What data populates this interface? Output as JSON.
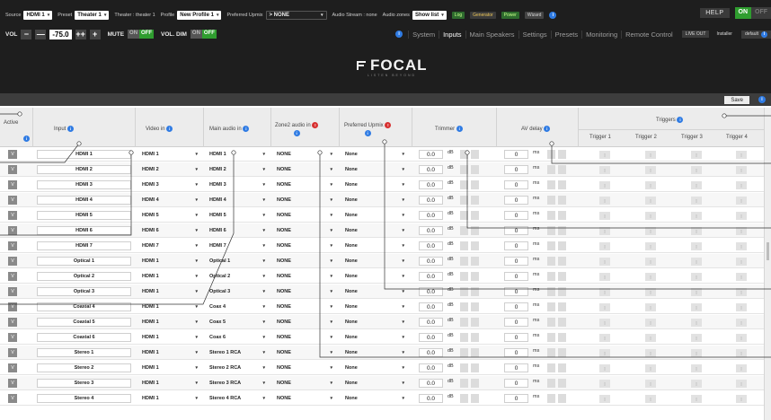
{
  "top": {
    "source": {
      "label": "Source",
      "value": "HDMI 1"
    },
    "preset": {
      "label": "Preset",
      "value": "Theater 1"
    },
    "theater": {
      "label": "Theater : theater 1"
    },
    "profile": {
      "label": "Profile",
      "value": "New Profile 1"
    },
    "upmix": {
      "label": "Preferred Upmix",
      "value": "> NONE"
    },
    "audio_stream": {
      "label": "Audio Stream : none"
    },
    "audio_zones": {
      "label": "Audio zones",
      "value": "Show list"
    },
    "log_label": "Log",
    "generator_label": "Generator",
    "power_label": "Power",
    "wizard_label": "Wizard",
    "help_label": "HELP",
    "on_label": "ON",
    "off_label": "OFF"
  },
  "volume": {
    "label": "VOL",
    "minus": "−",
    "minus2": "—",
    "value": "-75.0",
    "plus2": "++",
    "plus": "+",
    "mute_label": "MUTE",
    "mute_on": "ON",
    "mute_off": "OFF",
    "dim_label": "VOL. DIM",
    "dim_on": "ON",
    "dim_off": "OFF"
  },
  "nav": {
    "tabs": [
      "System",
      "Inputs",
      "Main Speakers",
      "Settings",
      "Presets",
      "Monitoring",
      "Remote Control"
    ],
    "active_tab": "Inputs",
    "live_label": "LIVE OUT",
    "installer_label": "Installer",
    "default_label": "default"
  },
  "brand": {
    "name": "FOCAL",
    "tagline": "LISTEN BEYOND"
  },
  "save_label": "Save",
  "table": {
    "headers": {
      "active": "Active",
      "input": "Input",
      "video_in": "Video in",
      "main_audio_in": "Main audio in",
      "zone2_audio_in": "Zone2 audio in",
      "preferred_upmix": "Preferred Upmix",
      "trimmer": "Trimmer",
      "av_delay": "AV delay",
      "triggers": "Triggers",
      "trigger_cols": [
        "Trigger 1",
        "Trigger 2",
        "Trigger 3",
        "Trigger 4"
      ]
    },
    "units": {
      "db": "dB",
      "ms": "ms"
    },
    "active_mark": "V",
    "rows": [
      {
        "input": "HDMI 1",
        "video": "HDMI 1",
        "audio": "HDMI 1",
        "zone2": "NONE",
        "upmix": "None",
        "trim": "0.0",
        "delay": "0"
      },
      {
        "input": "HDMI 2",
        "video": "HDMI 2",
        "audio": "HDMI 2",
        "zone2": "NONE",
        "upmix": "None",
        "trim": "0.0",
        "delay": "0"
      },
      {
        "input": "HDMI 3",
        "video": "HDMI 3",
        "audio": "HDMI 3",
        "zone2": "NONE",
        "upmix": "None",
        "trim": "0.0",
        "delay": "0"
      },
      {
        "input": "HDMI 4",
        "video": "HDMI 4",
        "audio": "HDMI 4",
        "zone2": "NONE",
        "upmix": "None",
        "trim": "0.0",
        "delay": "0"
      },
      {
        "input": "HDMI 5",
        "video": "HDMI 5",
        "audio": "HDMI 5",
        "zone2": "NONE",
        "upmix": "None",
        "trim": "0.0",
        "delay": "0"
      },
      {
        "input": "HDMI 6",
        "video": "HDMI 6",
        "audio": "HDMI 6",
        "zone2": "NONE",
        "upmix": "None",
        "trim": "0.0",
        "delay": "0"
      },
      {
        "input": "HDMI 7",
        "video": "HDMI 7",
        "audio": "HDMI 7",
        "zone2": "NONE",
        "upmix": "None",
        "trim": "0.0",
        "delay": "0"
      },
      {
        "input": "Optical 1",
        "video": "HDMI 1",
        "audio": "Optical 1",
        "zone2": "NONE",
        "upmix": "None",
        "trim": "0.0",
        "delay": "0"
      },
      {
        "input": "Optical 2",
        "video": "HDMI 1",
        "audio": "Optical 2",
        "zone2": "NONE",
        "upmix": "None",
        "trim": "0.0",
        "delay": "0"
      },
      {
        "input": "Optical 3",
        "video": "HDMI 1",
        "audio": "Optical 3",
        "zone2": "NONE",
        "upmix": "None",
        "trim": "0.0",
        "delay": "0"
      },
      {
        "input": "Coaxial 4",
        "video": "HDMI 1",
        "audio": "Coax 4",
        "zone2": "NONE",
        "upmix": "None",
        "trim": "0.0",
        "delay": "0"
      },
      {
        "input": "Coaxial 5",
        "video": "HDMI 1",
        "audio": "Coax 5",
        "zone2": "NONE",
        "upmix": "None",
        "trim": "0.0",
        "delay": "0"
      },
      {
        "input": "Coaxial 6",
        "video": "HDMI 1",
        "audio": "Coax 6",
        "zone2": "NONE",
        "upmix": "None",
        "trim": "0.0",
        "delay": "0"
      },
      {
        "input": "Stereo 1",
        "video": "HDMI 1",
        "audio": "Stereo 1 RCA",
        "zone2": "NONE",
        "upmix": "None",
        "trim": "0.0",
        "delay": "0"
      },
      {
        "input": "Stereo 2",
        "video": "HDMI 1",
        "audio": "Stereo 2 RCA",
        "zone2": "NONE",
        "upmix": "None",
        "trim": "0.0",
        "delay": "0"
      },
      {
        "input": "Stereo 3",
        "video": "HDMI 1",
        "audio": "Stereo 3 RCA",
        "zone2": "NONE",
        "upmix": "None",
        "trim": "0.0",
        "delay": "0"
      },
      {
        "input": "Stereo 4",
        "video": "HDMI 1",
        "audio": "Stereo 4 RCA",
        "zone2": "NONE",
        "upmix": "None",
        "trim": "0.0",
        "delay": "0"
      }
    ]
  },
  "colors": {
    "accent_green": "#2f9d2f",
    "info_blue": "#2f7be3",
    "warn_red": "#d73030",
    "top_bg": "#1e1e1e"
  }
}
